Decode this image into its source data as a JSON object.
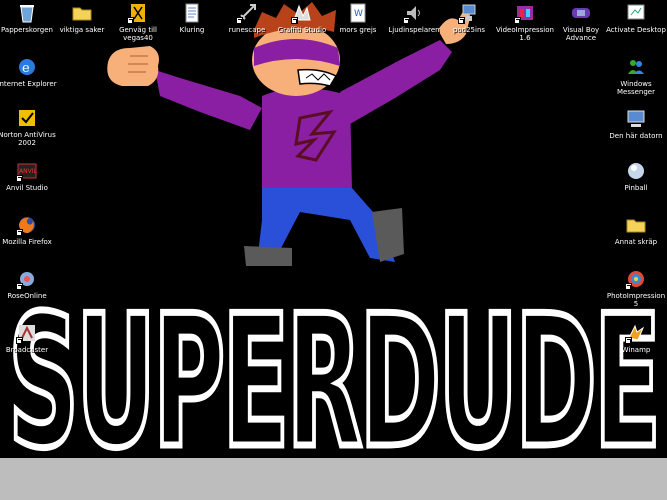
{
  "desktop": {
    "title_art": "SUPERDUDE",
    "icons_top": [
      {
        "name": "recycle-bin-icon",
        "label": "Papperskorgen"
      },
      {
        "name": "folder-icon",
        "label": "viktiga saker"
      },
      {
        "name": "vegas-icon",
        "label": "Genväg till vegas40"
      },
      {
        "name": "notepad-icon",
        "label": "Kluring"
      },
      {
        "name": "runescape-icon",
        "label": "runescape"
      },
      {
        "name": "graffiti-icon",
        "label": "Graffiti Studio"
      },
      {
        "name": "word-doc-icon",
        "label": "mors grejs"
      },
      {
        "name": "audio-icon",
        "label": "Ljudinspelaren"
      },
      {
        "name": "network-icon",
        "label": "pod25ins"
      },
      {
        "name": "videoimpression-icon",
        "label": "VideoImpression 1.6"
      },
      {
        "name": "gameboy-icon",
        "label": "Visual Boy Advance"
      },
      {
        "name": "activate-icon",
        "label": "Activate Desktop"
      }
    ],
    "icons_left": [
      {
        "name": "internet-explorer-icon",
        "label": "Internet Explorer"
      },
      {
        "name": "norton-icon",
        "label": "Norton AntiVirus 2002"
      },
      {
        "name": "anvil-icon",
        "label": "Anvil Studio"
      },
      {
        "name": "firefox-icon",
        "label": "Mozilla Firefox"
      },
      {
        "name": "roseonline-icon",
        "label": "RoseOnline"
      },
      {
        "name": "broadcaster-icon",
        "label": "Broadcaster"
      }
    ],
    "icons_right": [
      {
        "name": "messenger-icon",
        "label": "Windows Messenger"
      },
      {
        "name": "my-computer-icon",
        "label": "Den här datorn"
      },
      {
        "name": "pinball-icon",
        "label": "Pinball"
      },
      {
        "name": "folder-icon",
        "label": "Annat skräp"
      },
      {
        "name": "photoimpression-icon",
        "label": "PhotoImpression 5"
      },
      {
        "name": "winamp-icon",
        "label": "Winamp"
      }
    ],
    "colors": {
      "background": "#000000",
      "hero_suit": "#8b1fa3",
      "hero_pants": "#2a4fd8",
      "hero_skin": "#f7b07a",
      "hero_hair": "#b8431a",
      "ground": "#bdbdbd",
      "word_outline": "#ffffff"
    }
  }
}
